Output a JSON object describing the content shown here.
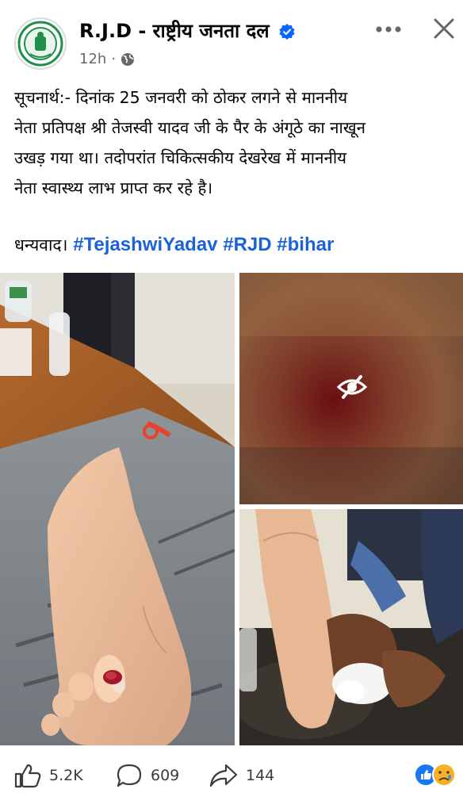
{
  "post": {
    "page_name": "R.J.D - राष्ट्रीय जनता दल",
    "time": "12h",
    "privacy_icon": "globe-icon",
    "body": "सूचनार्थ:- दिनांक 25 जनवरी को ठोकर लगने से माननीय\nनेता प्रतिपक्ष श्री तेजस्वी यादव जी के पैर के अंगूठे का नाखून\nउखड़ गया था। तदोपरांत चिकित्सकीय देखरेख में माननीय\nनेता स्वास्थ्य लाभ प्राप्त कर रहे है।",
    "thanks": "धन्यवाद।",
    "hashtags": [
      "#TejashwiYadav",
      "#RJD",
      "#bihar"
    ]
  },
  "actions": {
    "likes": "5.2K",
    "comments": "609",
    "shares": "144"
  },
  "colors": {
    "accent": "#1b62d8",
    "verified": "#0866ff",
    "like_reaction": "#1877f2",
    "sad_reaction": "#f7b125"
  }
}
